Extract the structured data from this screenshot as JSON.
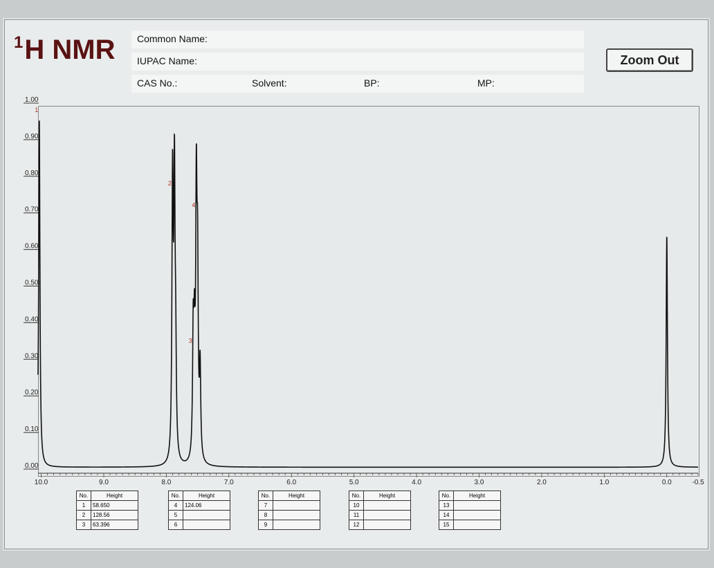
{
  "header": {
    "title_sup": "1",
    "title": "H NMR",
    "common_name_label": "Common Name:",
    "iupac_name_label": "IUPAC Name:",
    "cas_label": "CAS No.:",
    "solvent_label": "Solvent:",
    "bp_label": "BP:",
    "mp_label": "MP:",
    "zoom_button": "Zoom Out"
  },
  "peak_tables": [
    {
      "col_no": "No.",
      "col_height": "Height",
      "rows": [
        {
          "no": "1",
          "height": "58.650"
        },
        {
          "no": "2",
          "height": "128.56"
        },
        {
          "no": "3",
          "height": "63.396"
        }
      ]
    },
    {
      "col_no": "No.",
      "col_height": "Height",
      "rows": [
        {
          "no": "4",
          "height": "124.06"
        },
        {
          "no": "5",
          "height": ""
        },
        {
          "no": "6",
          "height": ""
        }
      ]
    },
    {
      "col_no": "No.",
      "col_height": "Height",
      "rows": [
        {
          "no": "7",
          "height": ""
        },
        {
          "no": "8",
          "height": ""
        },
        {
          "no": "9",
          "height": ""
        }
      ]
    },
    {
      "col_no": "No.",
      "col_height": "Height",
      "rows": [
        {
          "no": "10",
          "height": ""
        },
        {
          "no": "11",
          "height": ""
        },
        {
          "no": "12",
          "height": ""
        }
      ]
    },
    {
      "col_no": "No.",
      "col_height": "Height",
      "rows": [
        {
          "no": "13",
          "height": ""
        },
        {
          "no": "14",
          "height": ""
        },
        {
          "no": "15",
          "height": ""
        }
      ]
    }
  ],
  "chart_data": {
    "type": "line",
    "title": "",
    "xlabel": "",
    "ylabel": "",
    "xlim": [
      10.05,
      -0.5
    ],
    "ylim": [
      0,
      1.0
    ],
    "x_ticks": [
      "10.0",
      "9.0",
      "8.0",
      "7.0",
      "6.0",
      "5.0",
      "4.0",
      "3.0",
      "2.0",
      "1.0",
      "0.0",
      "-0.5"
    ],
    "x_tick_values": [
      10.0,
      9.0,
      8.0,
      7.0,
      6.0,
      5.0,
      4.0,
      3.0,
      2.0,
      1.0,
      0.0,
      -0.5
    ],
    "y_ticks": [
      "0.00",
      "0.10",
      "0.20",
      "0.30",
      "0.40",
      "0.50",
      "0.60",
      "0.70",
      "0.80",
      "0.90",
      "1.00"
    ],
    "y_tick_values": [
      0.0,
      0.1,
      0.2,
      0.3,
      0.4,
      0.5,
      0.6,
      0.7,
      0.8,
      0.9,
      1.0
    ],
    "line_color": "#111111",
    "label_color": "#b03020",
    "baseline": 0.005,
    "peaks": [
      {
        "x": 10.03,
        "y": 0.96,
        "label": "1"
      },
      {
        "x": 7.9,
        "y": 0.76,
        "label": "2"
      },
      {
        "x": 7.87,
        "y": 0.75,
        "label": ""
      },
      {
        "x": 7.85,
        "y": 0.25,
        "label": ""
      },
      {
        "x": 7.57,
        "y": 0.33,
        "label": "3"
      },
      {
        "x": 7.55,
        "y": 0.28,
        "label": ""
      },
      {
        "x": 7.52,
        "y": 0.7,
        "label": "4"
      },
      {
        "x": 7.5,
        "y": 0.48,
        "label": ""
      },
      {
        "x": 7.46,
        "y": 0.25,
        "label": ""
      },
      {
        "x": 0.0,
        "y": 0.64,
        "label": ""
      }
    ]
  }
}
